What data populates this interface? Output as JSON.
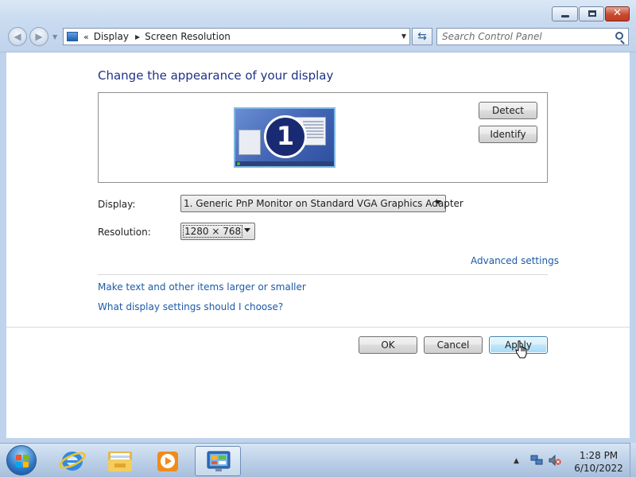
{
  "window": {
    "controls": {
      "minimize": "minimize",
      "maximize": "maximize",
      "close": "close"
    }
  },
  "addressbar": {
    "chevron": "«",
    "breadcrumbs": [
      "Display",
      "Screen Resolution"
    ],
    "icon": "control-panel-icon"
  },
  "search": {
    "placeholder": "Search Control Panel"
  },
  "main": {
    "heading": "Change the appearance of your display",
    "monitor_number": "1",
    "detect_label": "Detect",
    "identify_label": "Identify",
    "display_label": "Display:",
    "display_value": "1. Generic PnP Monitor on Standard VGA Graphics Adapter",
    "resolution_label": "Resolution:",
    "resolution_value": "1280 × 768",
    "advanced_link": "Advanced settings",
    "larger_link": "Make text and other items larger or smaller",
    "which_link": "What display settings should I choose?",
    "ok_label": "OK",
    "cancel_label": "Cancel",
    "apply_label": "Apply"
  },
  "taskbar": {
    "items": [
      "start-orb",
      "internet-explorer-icon",
      "windows-explorer-icon",
      "media-player-icon",
      "control-panel-icon"
    ],
    "tray_icons": [
      "show-hidden-icons",
      "network-icon",
      "volume-muted-icon"
    ],
    "time": "1:28 PM",
    "date": "6/10/2022"
  },
  "colors": {
    "heading": "#1e3287",
    "link": "#1c5aa6",
    "apply_border": "#3c7fb1"
  }
}
